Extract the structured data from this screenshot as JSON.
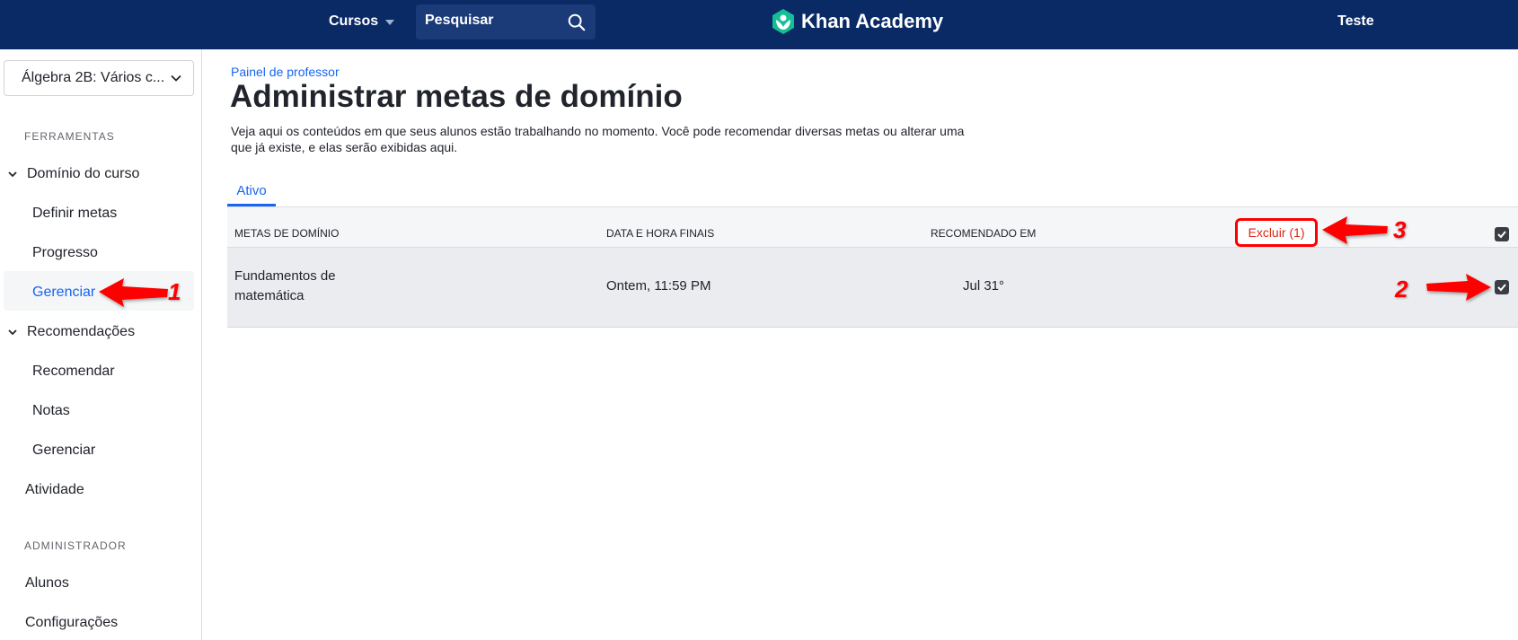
{
  "nav": {
    "courses_label": "Cursos",
    "search_placeholder": "Pesquisar",
    "logo_text": "Khan Academy",
    "user_label": "Teste",
    "bg_color": "#0a2a66"
  },
  "sidebar": {
    "course_select": "Álgebra 2B: Vários c...",
    "tools_heading": "FERRAMENTAS",
    "mastery_group": "Domínio do curso",
    "mastery_items": [
      "Definir metas",
      "Progresso",
      "Gerenciar"
    ],
    "recommendations_group": "Recomendações",
    "recommendation_items": [
      "Recomendar",
      "Notas",
      "Gerenciar"
    ],
    "activity": "Atividade",
    "admin_heading": "ADMINISTRADOR",
    "admin_items": [
      "Alunos",
      "Configurações"
    ],
    "active_item": "Gerenciar"
  },
  "main": {
    "breadcrumb": "Painel de professor",
    "title": "Administrar metas de domínio",
    "description": "Veja aqui os conteúdos em que seus alunos estão trabalhando no momento. Você pode recomendar diversas metas ou alterar uma que já existe, e elas serão exibidas aqui.",
    "tab_active": "Ativo",
    "table": {
      "headers": [
        "METAS DE DOMÍNIO",
        "DATA E HORA FINAIS",
        "RECOMENDADO EM"
      ],
      "delete_label": "Excluir (1)",
      "rows": [
        {
          "goal": "Fundamentos de matemática",
          "due": "Ontem, 11:59 PM",
          "recommended": "Jul 31°",
          "checked": true
        }
      ],
      "select_all_checked": true
    }
  },
  "annotations": {
    "labels": [
      "1",
      "2",
      "3"
    ],
    "color": "#ff0000"
  },
  "colors": {
    "accent": "#1865f2",
    "danger": "#d92916",
    "brand_green": "#14bf96"
  }
}
